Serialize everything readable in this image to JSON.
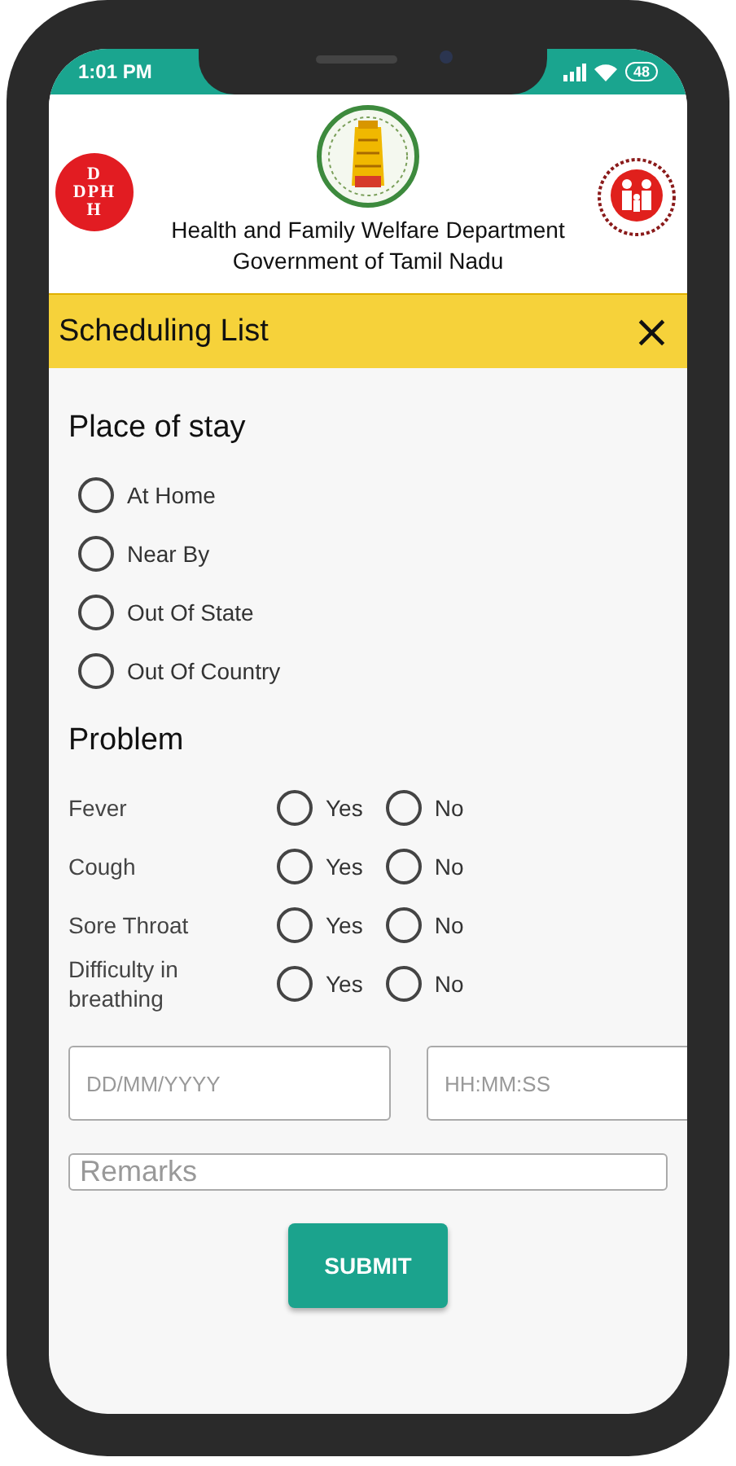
{
  "status_bar": {
    "time": "1:01 PM",
    "battery": "48"
  },
  "header": {
    "logo_letters": [
      "D",
      "DPH",
      "H"
    ],
    "lines": [
      "Health and Family Welfare Department",
      "Government of Tamil Nadu"
    ]
  },
  "toolbar": {
    "title": "Scheduling List",
    "close": "×"
  },
  "place_of_stay": {
    "title": "Place of stay",
    "options": [
      {
        "label": "At Home",
        "selected": false
      },
      {
        "label": "Near By",
        "selected": false
      },
      {
        "label": "Out Of State",
        "selected": false
      },
      {
        "label": "Out Of Country",
        "selected": false
      }
    ]
  },
  "problem": {
    "title": "Problem",
    "rows": [
      {
        "label": "Fever",
        "options": [
          {
            "label": "Yes",
            "selected": false
          },
          {
            "label": "No",
            "selected": false
          }
        ]
      },
      {
        "label": "Cough",
        "options": [
          {
            "label": "Yes",
            "selected": false
          },
          {
            "label": "No",
            "selected": false
          }
        ]
      },
      {
        "label": "Sore Throat",
        "options": [
          {
            "label": "Yes",
            "selected": false
          },
          {
            "label": "No",
            "selected": false
          }
        ]
      },
      {
        "label": "Difficulty in breathing",
        "options": [
          {
            "label": "Yes",
            "selected": false
          },
          {
            "label": "No",
            "selected": false
          }
        ]
      }
    ]
  },
  "date_field": {
    "placeholder": "DD/MM/YYYY"
  },
  "time_field": {
    "placeholder": "HH:MM:SS"
  },
  "remarks_field": {
    "placeholder": "Remarks"
  },
  "submit": "SUBMIT"
}
